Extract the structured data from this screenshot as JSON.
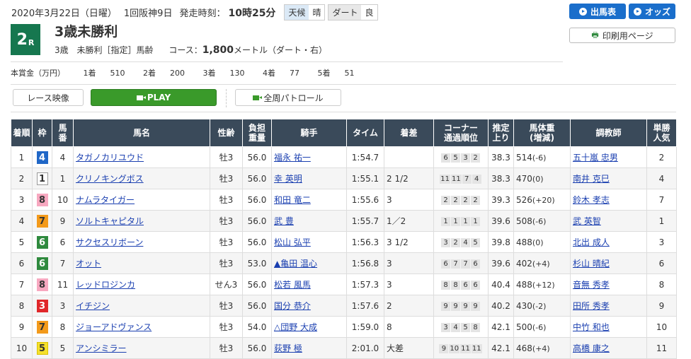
{
  "header": {
    "date": "2020年3月22日（日曜）",
    "meeting": "1回阪神9日",
    "post_time_label": "発走時刻：",
    "post_time": "10時25分",
    "weather_label": "天候",
    "weather": "晴",
    "track_label": "ダート",
    "track_condition": "良",
    "race_no": "2",
    "race_suffix": "R",
    "race_name": "3歳未勝利",
    "cond1": "3歳",
    "cond2": "未勝利［指定］馬齢",
    "course_label": "コース：",
    "distance": "1,800",
    "distance_unit": "メートル（ダート・右）"
  },
  "buttons": {
    "entries": "出馬表",
    "odds": "オッズ",
    "print": "印刷用ページ",
    "race_video": "レース映像",
    "play": "PLAY",
    "patrol": "全周パトロール"
  },
  "prize": {
    "label": "本賞金（万円）",
    "items": [
      {
        "place": "1着",
        "amount": "510"
      },
      {
        "place": "2着",
        "amount": "200"
      },
      {
        "place": "3着",
        "amount": "130"
      },
      {
        "place": "4着",
        "amount": "77"
      },
      {
        "place": "5着",
        "amount": "51"
      }
    ]
  },
  "table": {
    "headers": [
      "着順",
      "枠",
      "馬番",
      "馬名",
      "性齢",
      "負担重量",
      "騎手",
      "タイム",
      "着差",
      "コーナー通過順位",
      "推定上り",
      "馬体重(増減)",
      "調教師",
      "単勝人気"
    ],
    "rows": [
      {
        "pos": "1",
        "waku": "4",
        "num": "4",
        "horse": "タガノカリユウド",
        "sex": "牡3",
        "wt": "56.0",
        "jockey": "福永 祐一",
        "time": "1:54.7",
        "diff": "",
        "corner": [
          "6",
          "5",
          "3",
          "2"
        ],
        "last": "38.3",
        "bw": "514",
        "bwd": "(-6)",
        "trainer": "五十嵐 忠男",
        "pop": "2"
      },
      {
        "pos": "2",
        "waku": "1",
        "num": "1",
        "horse": "クリノキングボス",
        "sex": "牡3",
        "wt": "56.0",
        "jockey": "幸 英明",
        "time": "1:55.1",
        "diff": "2 1/2",
        "corner": [
          "11",
          "11",
          "7",
          "4"
        ],
        "last": "38.3",
        "bw": "470",
        "bwd": "(0)",
        "trainer": "南井 克巳",
        "pop": "4"
      },
      {
        "pos": "3",
        "waku": "8",
        "num": "10",
        "horse": "ナムラタイガー",
        "sex": "牡3",
        "wt": "56.0",
        "jockey": "和田 竜二",
        "time": "1:55.6",
        "diff": "3",
        "corner": [
          "2",
          "2",
          "2",
          "2"
        ],
        "last": "39.3",
        "bw": "526",
        "bwd": "(+20)",
        "trainer": "鈴木 孝志",
        "pop": "7"
      },
      {
        "pos": "4",
        "waku": "7",
        "num": "9",
        "horse": "ソルトキャピタル",
        "sex": "牡3",
        "wt": "56.0",
        "jockey": "武 豊",
        "time": "1:55.7",
        "diff": "1／2",
        "corner": [
          "1",
          "1",
          "1",
          "1"
        ],
        "last": "39.6",
        "bw": "508",
        "bwd": "(-6)",
        "trainer": "武 英智",
        "pop": "1"
      },
      {
        "pos": "5",
        "waku": "6",
        "num": "6",
        "horse": "サクセスリボーン",
        "sex": "牡3",
        "wt": "56.0",
        "jockey": "松山 弘平",
        "time": "1:56.3",
        "diff": "3 1/2",
        "corner": [
          "3",
          "2",
          "4",
          "5"
        ],
        "last": "39.8",
        "bw": "488",
        "bwd": "(0)",
        "trainer": "北出 成人",
        "pop": "3"
      },
      {
        "pos": "6",
        "waku": "6",
        "num": "7",
        "horse": "オット",
        "sex": "牡3",
        "wt": "53.0",
        "jockey": "▲亀田 温心",
        "time": "1:56.8",
        "diff": "3",
        "corner": [
          "6",
          "7",
          "7",
          "6"
        ],
        "last": "39.6",
        "bw": "402",
        "bwd": "(+4)",
        "trainer": "杉山 晴紀",
        "pop": "6"
      },
      {
        "pos": "7",
        "waku": "8",
        "num": "11",
        "horse": "レッドロジンカ",
        "sex": "せん3",
        "wt": "56.0",
        "jockey": "松若 風馬",
        "time": "1:57.3",
        "diff": "3",
        "corner": [
          "8",
          "8",
          "6",
          "6"
        ],
        "last": "40.4",
        "bw": "488",
        "bwd": "(+12)",
        "trainer": "音無 秀孝",
        "pop": "8"
      },
      {
        "pos": "8",
        "waku": "3",
        "num": "3",
        "horse": "イチジン",
        "sex": "牡3",
        "wt": "56.0",
        "jockey": "国分 恭介",
        "time": "1:57.6",
        "diff": "2",
        "corner": [
          "9",
          "9",
          "9",
          "9"
        ],
        "last": "40.2",
        "bw": "430",
        "bwd": "(-2)",
        "trainer": "田所 秀孝",
        "pop": "9"
      },
      {
        "pos": "9",
        "waku": "7",
        "num": "8",
        "horse": "ジョーアドヴァンス",
        "sex": "牡3",
        "wt": "54.0",
        "jockey": "△団野 大成",
        "time": "1:59.0",
        "diff": "8",
        "corner": [
          "3",
          "4",
          "5",
          "8"
        ],
        "last": "42.1",
        "bw": "500",
        "bwd": "(-6)",
        "trainer": "中竹 和也",
        "pop": "10"
      },
      {
        "pos": "10",
        "waku": "5",
        "num": "5",
        "horse": "アンシミラー",
        "sex": "牡3",
        "wt": "56.0",
        "jockey": "荻野 極",
        "time": "2:01.0",
        "diff": "大差",
        "corner": [
          "9",
          "10",
          "11",
          "11"
        ],
        "last": "42.1",
        "bw": "468",
        "bwd": "(+4)",
        "trainer": "高橋 康之",
        "pop": "11"
      }
    ]
  },
  "waku_colors": {
    "1": {
      "bg": "#ffffff",
      "fg": "#333333",
      "border": "#999999"
    },
    "2": {
      "bg": "#222222",
      "fg": "#ffffff",
      "border": "#222222"
    },
    "3": {
      "bg": "#e0272a",
      "fg": "#ffffff",
      "border": "#e0272a"
    },
    "4": {
      "bg": "#2067c7",
      "fg": "#ffffff",
      "border": "#2067c7"
    },
    "5": {
      "bg": "#f5e02c",
      "fg": "#333333",
      "border": "#d9c200"
    },
    "6": {
      "bg": "#2f8a3e",
      "fg": "#ffffff",
      "border": "#2f8a3e"
    },
    "7": {
      "bg": "#f39a1b",
      "fg": "#333333",
      "border": "#f39a1b"
    },
    "8": {
      "bg": "#f7a8c0",
      "fg": "#333333",
      "border": "#f7a8c0"
    }
  },
  "chart_data": {
    "type": "table",
    "columns": [
      "着順",
      "枠",
      "馬番",
      "馬名",
      "性齢",
      "負担重量",
      "騎手",
      "タイム",
      "着差",
      "コーナー通過順位",
      "推定上り",
      "馬体重(増減)",
      "調教師",
      "単勝人気"
    ]
  }
}
